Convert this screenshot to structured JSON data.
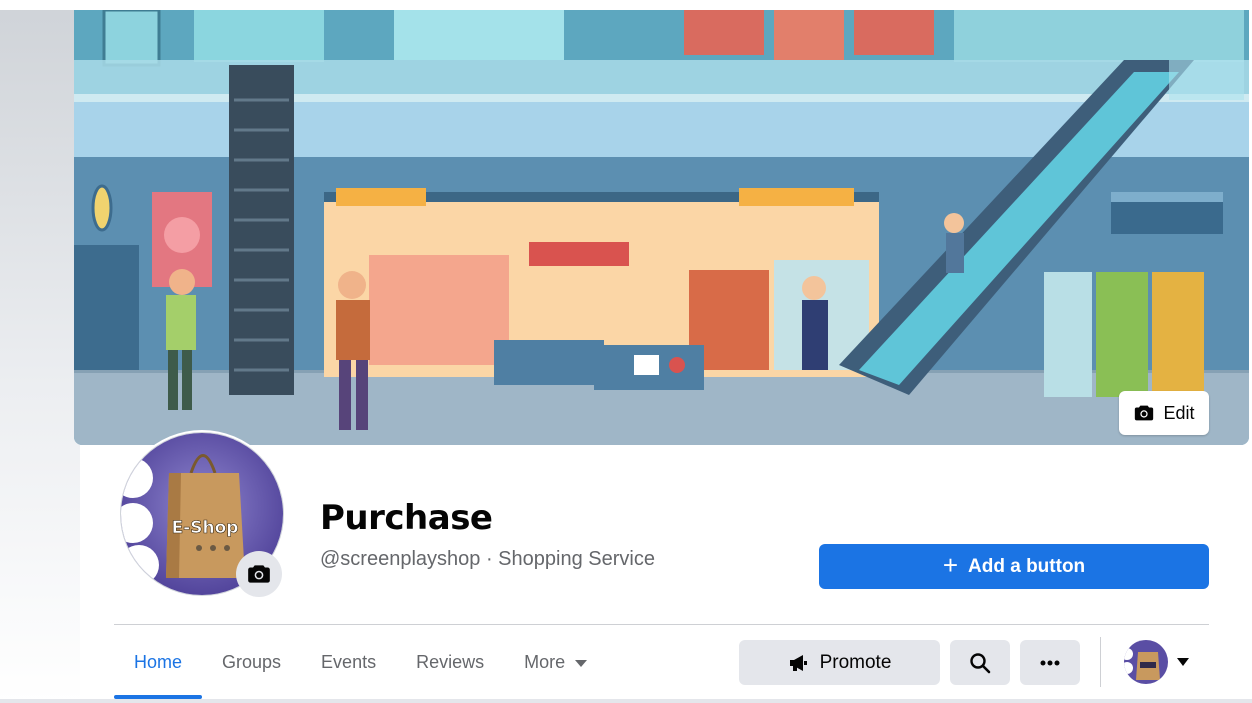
{
  "cover": {
    "edit_label": "Edit"
  },
  "profile": {
    "name": "Purchase",
    "handle": "@screenplayshop",
    "separator": " · ",
    "category": "Shopping Service",
    "logo_text": "E-Shop"
  },
  "cta": {
    "add_button_label": "Add a button",
    "plus": "+"
  },
  "tabs": [
    {
      "label": "Home",
      "active": true
    },
    {
      "label": "Groups"
    },
    {
      "label": "Events"
    },
    {
      "label": "Reviews"
    },
    {
      "label": "More"
    }
  ],
  "actions": {
    "promote_label": "Promote"
  },
  "colors": {
    "accent": "#1b74e4",
    "secondary_text": "#65676b",
    "button_gray": "#e4e6eb"
  },
  "icons": [
    "camera-icon",
    "plus-icon",
    "megaphone-icon",
    "search-icon",
    "ellipsis-icon",
    "chevron-down-icon"
  ]
}
